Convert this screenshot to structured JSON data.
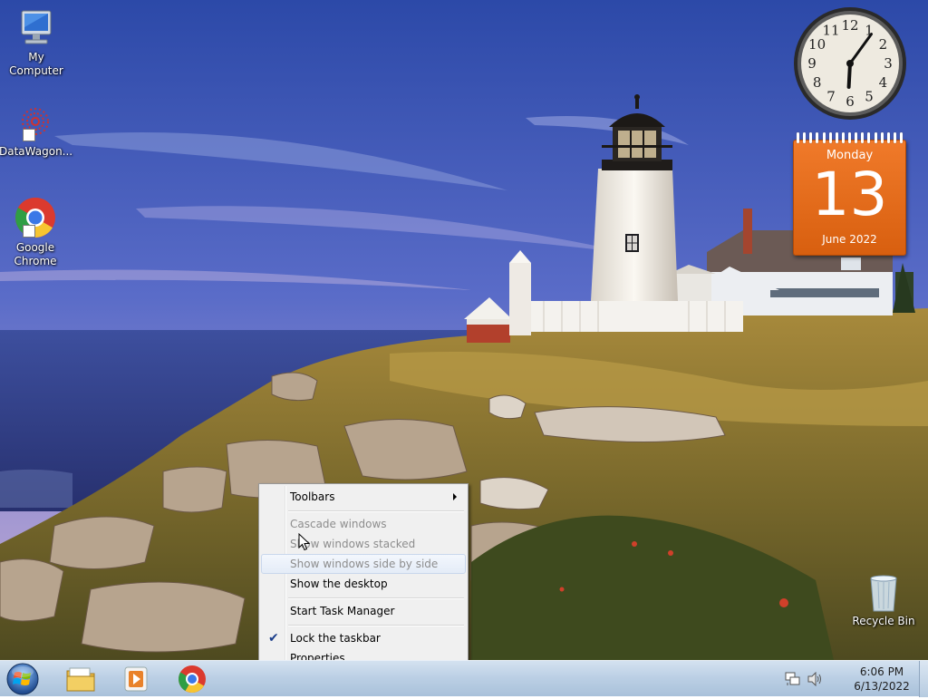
{
  "desktop": {
    "icons": [
      {
        "label": "My Computer"
      },
      {
        "label": "DataWagon..."
      },
      {
        "label": "Google Chrome"
      },
      {
        "label": "Recycle Bin"
      }
    ]
  },
  "gadgets": {
    "clock": {
      "numerals": [
        "12",
        "1",
        "2",
        "3",
        "4",
        "5",
        "6",
        "7",
        "8",
        "9",
        "10",
        "11"
      ],
      "hour": 6,
      "minute": 6
    },
    "calendar": {
      "day_name": "Monday",
      "day_number": "13",
      "month_year": "June 2022"
    }
  },
  "context_menu": {
    "items": [
      {
        "label": "Toolbars",
        "state": "enabled",
        "submenu": true
      },
      {
        "label": "Cascade windows",
        "state": "disabled"
      },
      {
        "label": "Show windows stacked",
        "state": "disabled"
      },
      {
        "label": "Show windows side by side",
        "state": "disabled"
      },
      {
        "label": "Show the desktop",
        "state": "enabled"
      },
      {
        "label": "Start Task Manager",
        "state": "enabled"
      },
      {
        "label": "Lock the taskbar",
        "state": "enabled",
        "checked": true
      },
      {
        "label": "Properties",
        "state": "enabled"
      }
    ]
  },
  "taskbar": {
    "pinned": [
      {
        "icon": "windows-explorer-icon"
      },
      {
        "icon": "media-player-icon"
      },
      {
        "icon": "chrome-icon"
      }
    ],
    "tray": {
      "time": "6:06 PM",
      "date": "6/13/2022",
      "icons": [
        "network-icon",
        "volume-icon"
      ]
    }
  },
  "colors": {
    "accent": "#e8701f",
    "taskbar": "#bcd0e5",
    "sky_top": "#2f4ea8",
    "sky_bottom": "#a99ad4"
  }
}
